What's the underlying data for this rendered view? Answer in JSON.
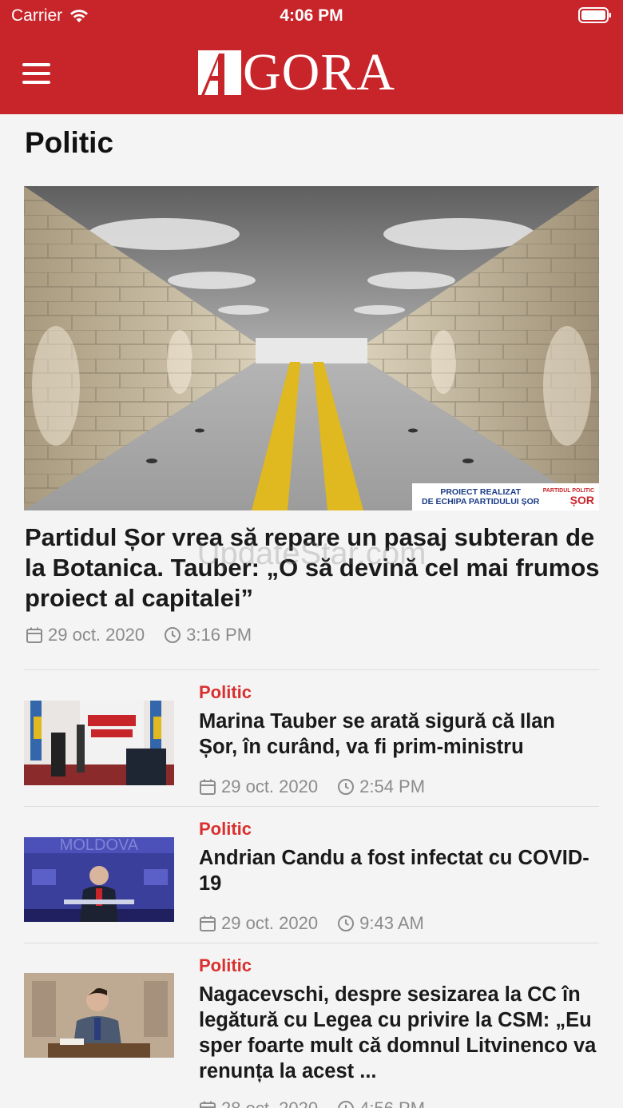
{
  "status_bar": {
    "carrier": "Carrier",
    "time": "4:06 PM"
  },
  "header": {
    "logo_text": "GORA",
    "logo_letter": "A",
    "menu_icon": "hamburger-icon"
  },
  "page_title": "Politic",
  "watermark": "UpdateStar.com",
  "featured": {
    "image_caption_line1": "PROIECT REALIZAT",
    "image_caption_line2": "DE ECHIPA PARTIDULUI ȘOR",
    "image_brand_small": "PARTIDUL POLITIC",
    "image_brand_big": "ȘOR",
    "title": "Partidul Șor vrea să repare un pasaj subteran de la Botanica. Tauber: „O să devină cel mai frumos proiect al capitalei”",
    "date": "29 oct. 2020",
    "time": "3:16 PM"
  },
  "articles": [
    {
      "category": "Politic",
      "title": "Marina Tauber se arată sigură că Ilan Șor, în curând, va fi prim-ministru",
      "date": "29 oct. 2020",
      "time": "2:54 PM"
    },
    {
      "category": "Politic",
      "title": "Andrian Candu a fost infectat cu COVID-19",
      "date": "29 oct. 2020",
      "time": "9:43 AM"
    },
    {
      "category": "Politic",
      "title": "Nagacevschi, despre sesizarea la CC în legătură cu Legea cu privire la CSM: „Eu sper foarte mult că domnul Litvinenco va renunța la acest ...",
      "date": "28 oct. 2020",
      "time": "4:56 PM"
    }
  ],
  "colors": {
    "brand_red": "#c8252b",
    "category_red": "#d9302f",
    "meta_gray": "#8c8c8c"
  }
}
